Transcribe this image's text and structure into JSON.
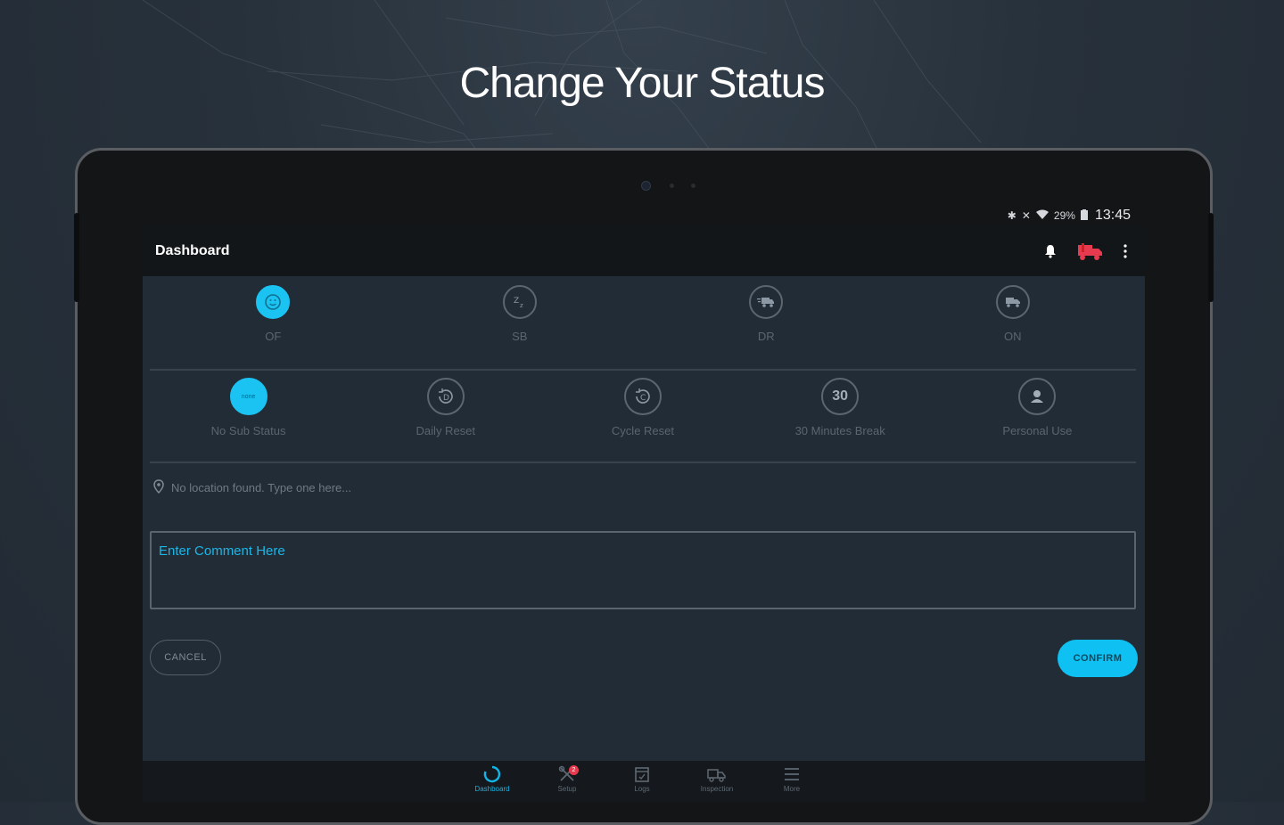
{
  "promo": {
    "title": "Change Your Status"
  },
  "statusbar": {
    "battery": "29%",
    "time": "13:45"
  },
  "appbar": {
    "title": "Dashboard"
  },
  "duty_status": [
    {
      "label": "OF",
      "active": true
    },
    {
      "label": "SB",
      "active": false
    },
    {
      "label": "DR",
      "active": false
    },
    {
      "label": "ON",
      "active": false
    }
  ],
  "sub_status": [
    {
      "label": "No Sub Status",
      "icon_text": "none",
      "active": true
    },
    {
      "label": "Daily Reset",
      "icon_text": "D",
      "active": false
    },
    {
      "label": "Cycle Reset",
      "icon_text": "C",
      "active": false
    },
    {
      "label": "30 Minutes Break",
      "icon_text": "30",
      "active": false
    },
    {
      "label": "Personal Use",
      "icon_text": "",
      "active": false
    }
  ],
  "location": {
    "placeholder": "No location found. Type one here..."
  },
  "comment": {
    "placeholder": "Enter Comment Here"
  },
  "buttons": {
    "cancel": "CANCEL",
    "confirm": "CONFIRM"
  },
  "bottom_nav": {
    "items": [
      {
        "label": "Dashboard",
        "icon": "dashboard-spinner-icon",
        "active": true
      },
      {
        "label": "Setup",
        "icon": "tools-icon",
        "badge": "2"
      },
      {
        "label": "Logs",
        "icon": "log-book-icon"
      },
      {
        "label": "Inspection",
        "icon": "truck-inspection-icon"
      },
      {
        "label": "More",
        "icon": "menu-lines-icon"
      }
    ]
  },
  "colors": {
    "accent": "#1bc3f3",
    "screen_bg": "#222c36",
    "alert_red": "#e83a4e"
  }
}
